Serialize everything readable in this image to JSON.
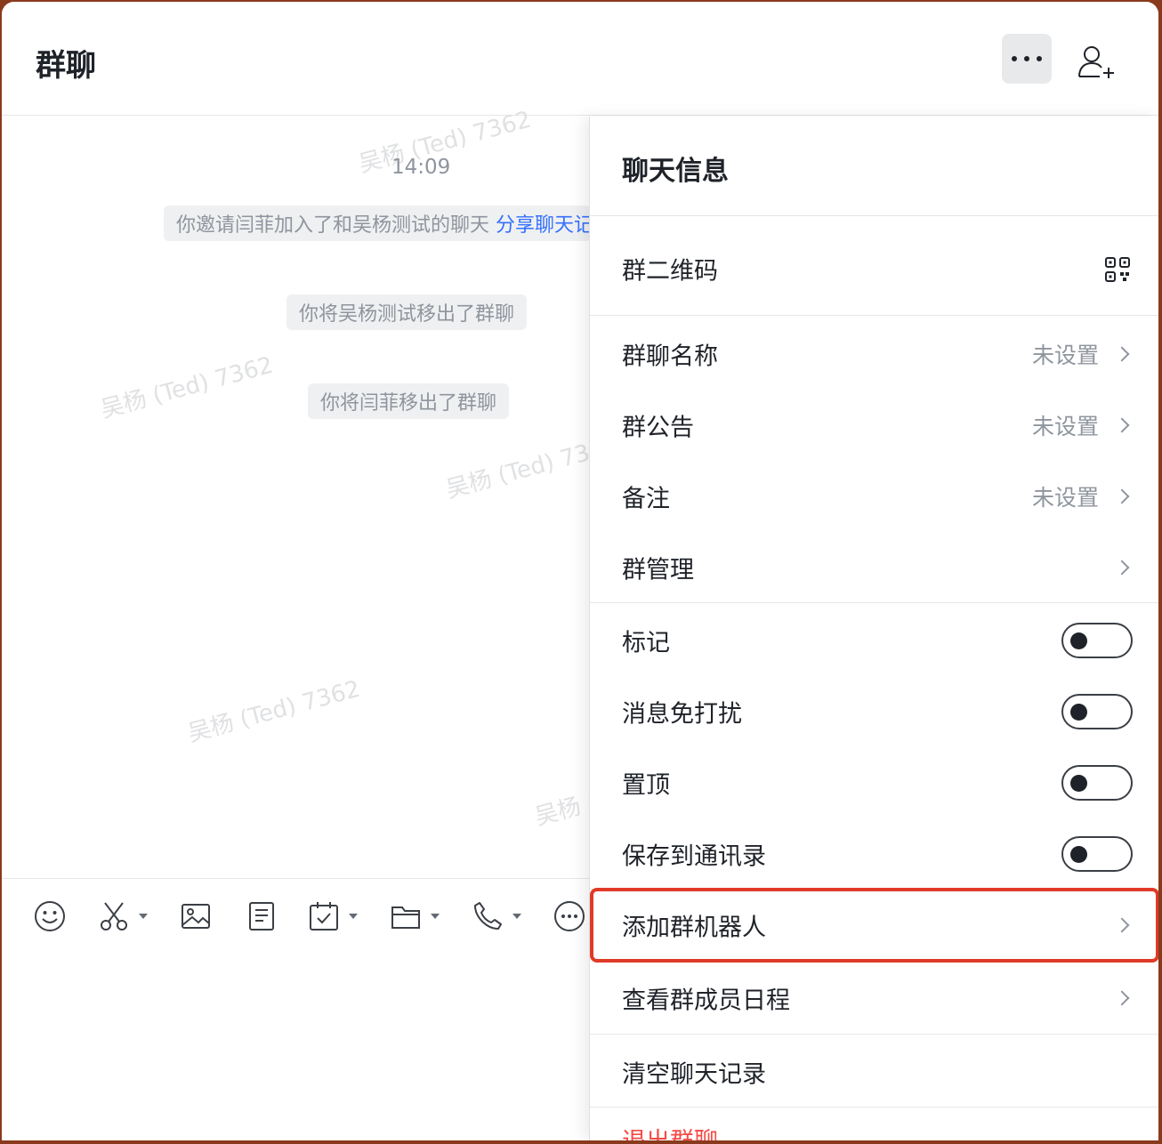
{
  "header": {
    "title": "群聊"
  },
  "chat": {
    "watermark": "吴杨 (Ted) 7362",
    "time": "14:09",
    "messages": {
      "invite_text": "你邀请闫菲加入了和吴杨测试的聊天 ",
      "invite_link": "分享聊天记录",
      "removed_wu": "你将吴杨测试移出了群聊",
      "removed_yan": "你将闫菲移出了群聊"
    }
  },
  "toolbar": {
    "items": [
      "emoji-icon",
      "scissors-icon",
      "image-icon",
      "document-icon",
      "calendar-check-icon",
      "folder-icon",
      "phone-icon",
      "more-circle-icon"
    ]
  },
  "panel": {
    "title": "聊天信息",
    "qr_label": "群二维码",
    "group_name_label": "群聊名称",
    "group_name_value": "未设置",
    "announcement_label": "群公告",
    "announcement_value": "未设置",
    "remark_label": "备注",
    "remark_value": "未设置",
    "manage_label": "群管理",
    "mark_label": "标记",
    "mute_label": "消息免打扰",
    "pin_label": "置顶",
    "save_contacts_label": "保存到通讯录",
    "add_bot_label": "添加群机器人",
    "schedule_label": "查看群成员日程",
    "clear_history_label": "清空聊天记录",
    "leave_label": "退出群聊"
  },
  "colors": {
    "highlight": "#e03a28",
    "link": "#3370ff",
    "danger": "#f54a45"
  }
}
